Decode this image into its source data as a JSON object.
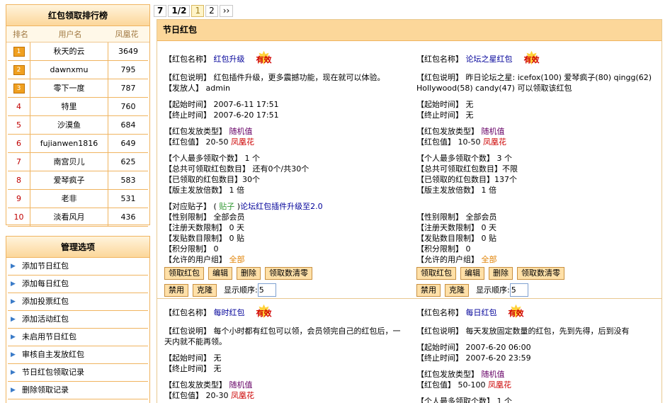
{
  "ranking": {
    "title": "红包领取排行榜",
    "headers": [
      "排名",
      "用户名",
      "凤凰花"
    ],
    "rows": [
      {
        "rank": "1",
        "name": "秋天的云",
        "value": "3649"
      },
      {
        "rank": "2",
        "name": "dawnxmu",
        "value": "795"
      },
      {
        "rank": "3",
        "name": "零下一度",
        "value": "787"
      },
      {
        "rank": "4",
        "name": "特里",
        "value": "760"
      },
      {
        "rank": "5",
        "name": "沙漠鱼",
        "value": "684"
      },
      {
        "rank": "6",
        "name": "fujianwen1816",
        "value": "649"
      },
      {
        "rank": "7",
        "name": "南宫贝儿",
        "value": "625"
      },
      {
        "rank": "8",
        "name": "爱琴疯子",
        "value": "583"
      },
      {
        "rank": "9",
        "name": "老非",
        "value": "531"
      },
      {
        "rank": "10",
        "name": "淡看风月",
        "value": "436"
      }
    ]
  },
  "admin": {
    "title": "管理选项",
    "items": [
      "添加节日红包",
      "添加每日红包",
      "添加投票红包",
      "添加活动红包",
      "未启用节日红包",
      "审核自主发放红包",
      "节日红包领取记录",
      "删除领取记录"
    ]
  },
  "pager": {
    "total": "7",
    "page": "1/2",
    "current": "1",
    "next": "2",
    "last": "››"
  },
  "main": {
    "title": "节日红包"
  },
  "badge": "有效",
  "buttons": {
    "receive": "领取红包",
    "edit": "编辑",
    "delete": "删除",
    "reset": "领取数清零",
    "disable": "禁用",
    "clone": "克隆",
    "order_label": "显示顺序:"
  },
  "labels": {
    "name": "【红包名称】",
    "desc": "【红包说明】",
    "issuer": "【发放人】",
    "start": "【起始时间】",
    "end": "【终止时间】",
    "type": "【红包发放类型】",
    "value": "【红包值】",
    "max": "【个人最多领取个数】",
    "total": "【总共可领取红包数目】",
    "received": "【已领取的红包数目】",
    "multiple": "【版主发放倍数】",
    "topic": "【对应贴子】",
    "gender": "【性别限制】",
    "regdays": "【注册天数限制】",
    "posts": "【发贴数目限制】",
    "points": "【积分限制】",
    "groups": "【允许的用户组】"
  },
  "packets": [
    {
      "name": "红包升级",
      "desc": "红包插件升级，更多震撼功能，现在就可以体验。",
      "issuer": "admin",
      "start": "2007-6-11 17:51",
      "end": "2007-6-20 17:51",
      "type": "随机值",
      "value": "20-50",
      "currency": "凤凰花",
      "max": "1 个",
      "total": "还有0个/共30个",
      "received": "30个",
      "multiple": "1 倍",
      "topic_prefix": "( ",
      "topic_tag": "贴子",
      "topic_suffix": " )",
      "topic_link": "论坛红包插件升级至2.0",
      "gender": "全部会员",
      "regdays": "0 天",
      "posts": "0 贴",
      "points": "0",
      "groups": "全部",
      "order": "5"
    },
    {
      "name": "论坛之星红包",
      "desc": "昨日论坛之星: icefox(100) 爱琴疯子(80) qingg(62) Hollywood(58) candy(47) 可以领取该红包",
      "start": "无",
      "end": "无",
      "type": "随机值",
      "value": "10-50",
      "currency": "凤凰花",
      "max": "3 个",
      "total": "不限",
      "received": "137个",
      "multiple": "1 倍",
      "gender": "全部会员",
      "regdays": "0 天",
      "posts": "0 贴",
      "points": "0",
      "groups": "全部",
      "order": "5"
    },
    {
      "name": "每时红包",
      "desc": "每个小时都有红包可以领，会员领完自己的红包后，一天内就不能再领。",
      "start": "无",
      "end": "无",
      "type": "随机值",
      "value": "20-30",
      "currency": "凤凰花"
    },
    {
      "name": "每日红包",
      "desc": "每天发放固定数量的红包，先到先得，后到没有",
      "start": "2007-6-20 06:00",
      "end": "2007-6-20 23:59",
      "type": "随机值",
      "value": "50-100",
      "currency": "凤凰花",
      "max": "1 个"
    }
  ]
}
